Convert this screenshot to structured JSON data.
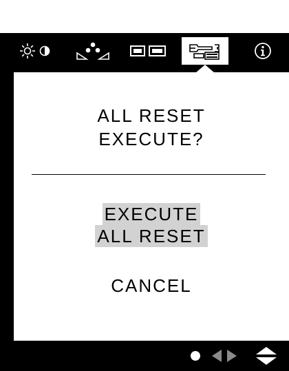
{
  "tabs": [
    {
      "name": "brightness-contrast",
      "icon": "brightness-contrast-icon",
      "selected": false
    },
    {
      "name": "color",
      "icon": "color-icon",
      "selected": false
    },
    {
      "name": "screen",
      "icon": "screen-size-icon",
      "selected": false
    },
    {
      "name": "tools",
      "icon": "tools-icon",
      "selected": true
    },
    {
      "name": "information",
      "icon": "info-icon",
      "selected": false
    }
  ],
  "dialog": {
    "title_line1": "ALL RESET",
    "title_line2": "EXECUTE?",
    "execute_line1": "EXECUTE",
    "execute_line2": "ALL RESET",
    "cancel": "CANCEL"
  },
  "nav_hints": [
    "select-dot-icon",
    "left-right-arrows-icon",
    "up-down-arrows-icon"
  ],
  "colors": {
    "background": "#000000",
    "panel": "#ffffff",
    "highlight": "#d2d2d2"
  }
}
